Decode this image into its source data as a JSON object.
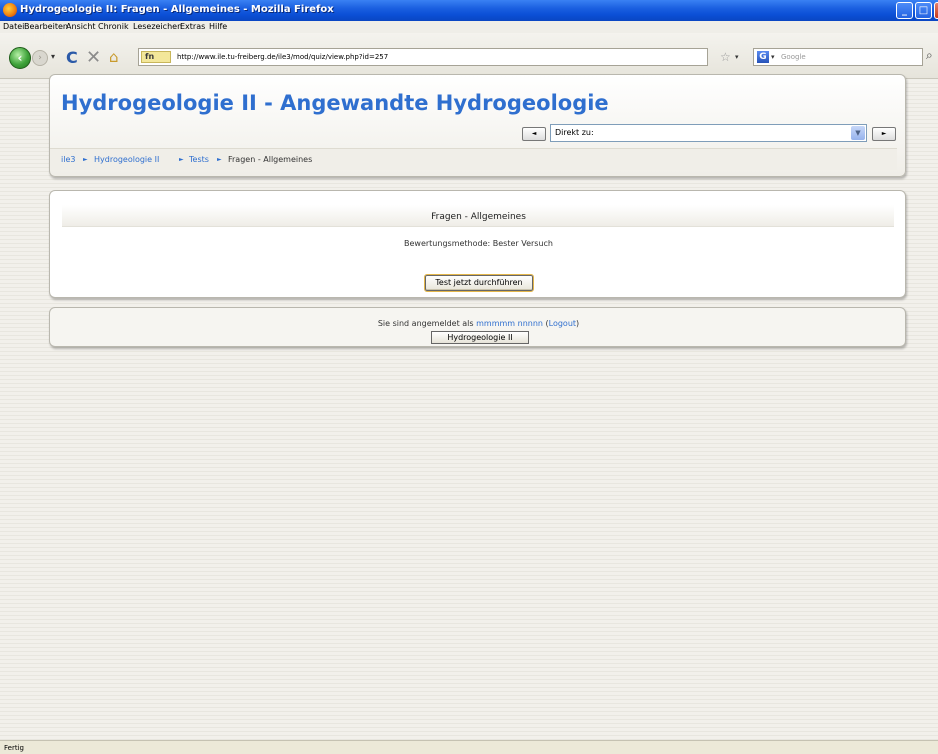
{
  "window": {
    "title": "Hydrogeologie II: Fragen - Allgemeines - Mozilla Firefox"
  },
  "menu": [
    "Datei",
    "Bearbeiten",
    "Ansicht",
    "Chronik",
    "Lesezeichen",
    "Extras",
    "Hilfe"
  ],
  "toolbar": {
    "url": "http://www.ile.tu-freiberg.de/ile3/mod/quiz/view.php?id=257",
    "search_placeholder": "Google"
  },
  "header": {
    "title": "Hydrogeologie II - Angewandte Hydrogeologie",
    "jump_label": "Direkt zu:",
    "prev_label": "◄",
    "next_label": "►"
  },
  "breadcrumb": {
    "items": [
      "ile3",
      "Hydrogeologie II",
      "Tests"
    ],
    "current": "Fragen - Allgemeines",
    "separator": "►"
  },
  "quiz": {
    "title": "Fragen - Allgemeines",
    "grading": "Bewertungsmethode: Bester Versuch",
    "start_button": "Test jetzt durchführen"
  },
  "footer": {
    "prefix": "Sie sind angemeldet als",
    "user": "mmmmm nnnnn",
    "logout": "Logout",
    "course_button": "Hydrogeologie II"
  },
  "status": {
    "text": "Fertig"
  },
  "colors": {
    "link": "#2f6fcf",
    "titlebar": "#0b4fd6"
  }
}
